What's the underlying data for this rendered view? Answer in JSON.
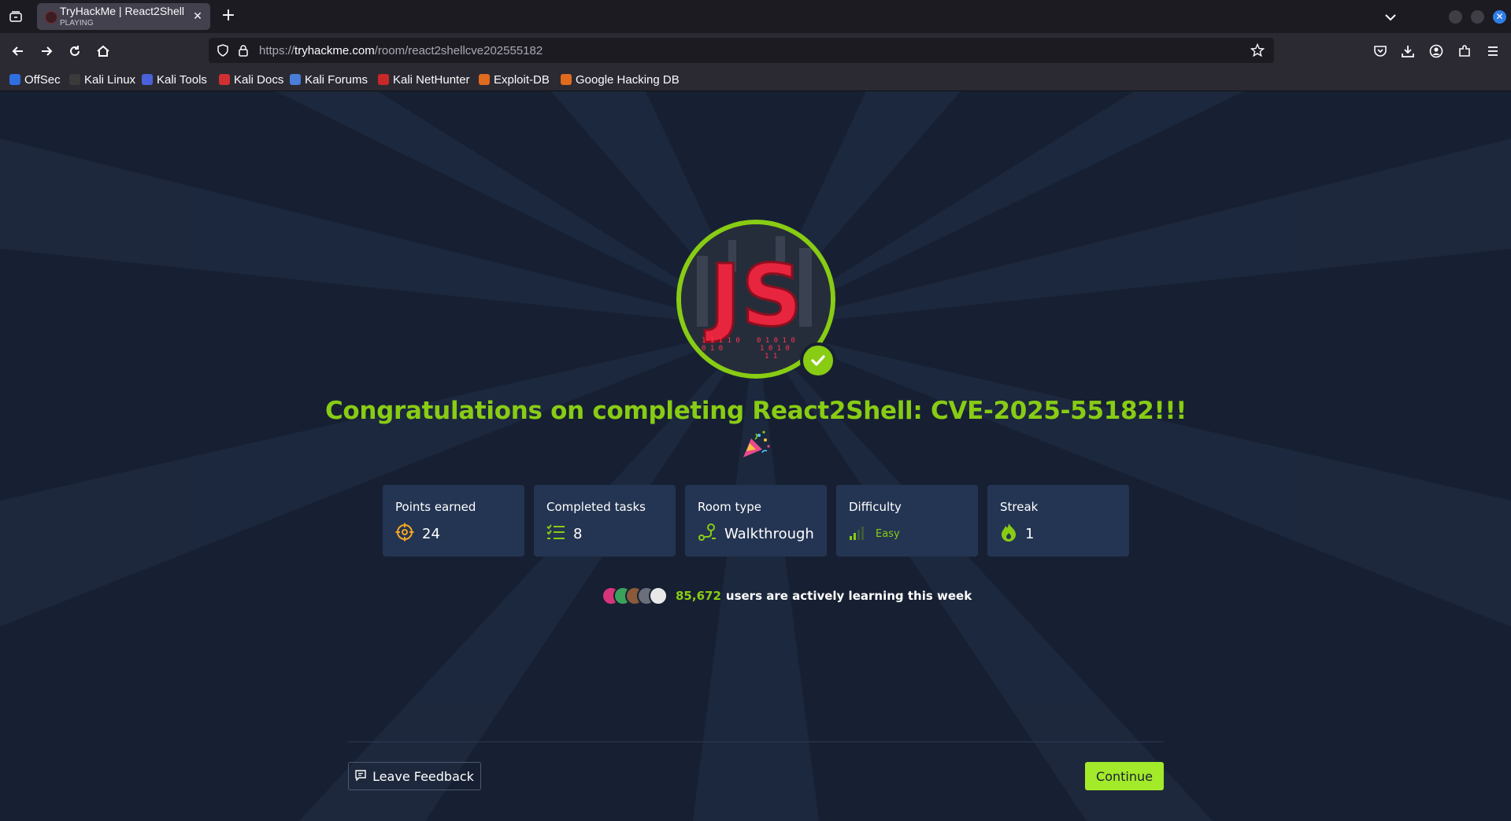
{
  "browser": {
    "tab": {
      "title": "TryHackMe | React2Shell",
      "subtitle": "PLAYING"
    },
    "url": {
      "scheme": "https://",
      "host": "tryhackme.com",
      "path": "/room/react2shellcve202555182"
    },
    "bookmarks": [
      {
        "label": "OffSec",
        "color": "#2f6fe0"
      },
      {
        "label": "Kali Linux",
        "color": "#3a3a3a"
      },
      {
        "label": "Kali Tools",
        "color": "#4a62d8"
      },
      {
        "label": "Kali Docs",
        "color": "#d03030"
      },
      {
        "label": "Kali Forums",
        "color": "#4a7ed8"
      },
      {
        "label": "Kali NetHunter",
        "color": "#c82828"
      },
      {
        "label": "Exploit-DB",
        "color": "#e06a1e"
      },
      {
        "label": "Google Hacking DB",
        "color": "#e06a1e"
      }
    ]
  },
  "page": {
    "badge_text": "JS",
    "congrats": "Congratulations on completing React2Shell: CVE-2025-55182!!!",
    "stats": [
      {
        "label": "Points earned",
        "value": "24",
        "icon": "target-icon"
      },
      {
        "label": "Completed tasks",
        "value": "8",
        "icon": "checklist-icon"
      },
      {
        "label": "Room type",
        "value": "Walkthrough",
        "icon": "route-icon"
      },
      {
        "label": "Difficulty",
        "value": "Easy",
        "icon": "signal-bars-icon"
      },
      {
        "label": "Streak",
        "value": "1",
        "icon": "flame-icon"
      }
    ],
    "active_users": {
      "count": "85,672",
      "text": "users are actively learning this week"
    },
    "feedback_label": "Leave Feedback",
    "continue_label": "Continue"
  },
  "colors": {
    "accent": "#88cc14",
    "card": "#243553",
    "page_bg": "#172032"
  }
}
